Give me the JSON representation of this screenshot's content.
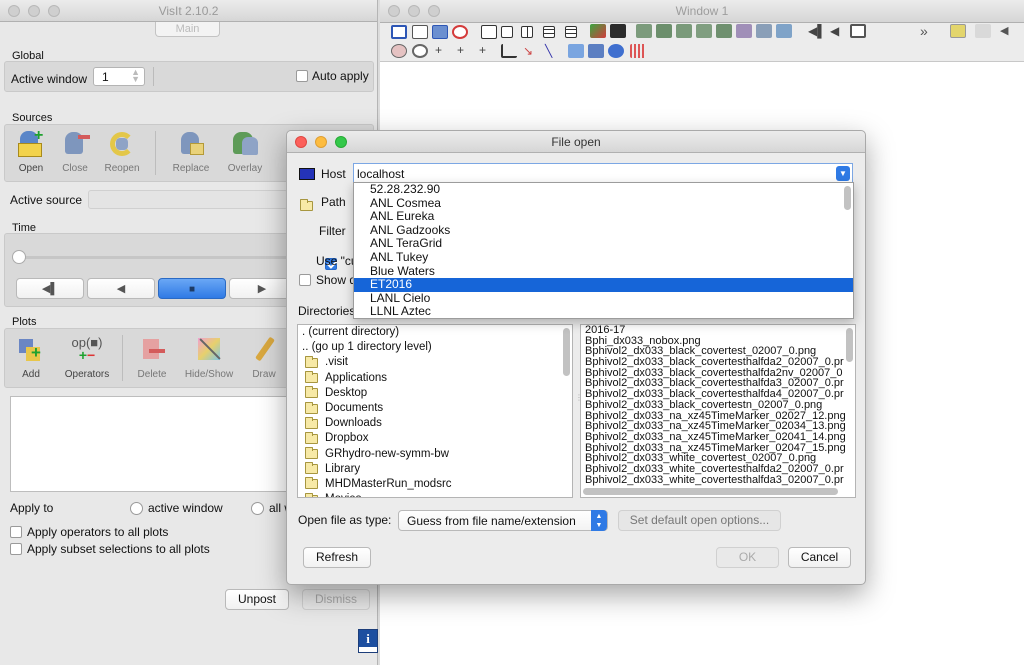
{
  "main_window": {
    "title": "VisIt 2.10.2",
    "tab_label": "Main",
    "global": {
      "label": "Global",
      "active_window_label": "Active window",
      "active_window_value": "1",
      "auto_apply_label": "Auto apply"
    },
    "sources": {
      "label": "Sources",
      "tools": [
        "Open",
        "Close",
        "Reopen",
        "Replace",
        "Overlay"
      ],
      "active_source_label": "Active source"
    },
    "time": {
      "label": "Time"
    },
    "plots": {
      "label": "Plots",
      "tools": [
        "Add",
        "Operators",
        "Delete",
        "Hide/Show",
        "Draw"
      ],
      "operators_icon_text": "op(■)"
    },
    "apply_to": {
      "label": "Apply to",
      "active_window": "active window",
      "all_windows": "all w",
      "apply_operators": "Apply operators to all plots",
      "apply_subset": "Apply subset selections to all plots"
    },
    "unpost_label": "Unpost",
    "dismiss_label": "Dismiss"
  },
  "viewer_window": {
    "title": "Window 1",
    "more_label": "»"
  },
  "file_open_dialog": {
    "title": "File open",
    "host_label": "Host",
    "host_value": "localhost",
    "path_label": "Path",
    "filter_label": "Filter",
    "use_current_label": "Use \"cu",
    "show_dot_label": "Show d",
    "directories_label": "Directories",
    "host_options": [
      "52.28.232.90",
      "ANL Cosmea",
      "ANL Eureka",
      "ANL Gadzooks",
      "ANL TeraGrid",
      "ANL Tukey",
      "Blue Waters",
      "ET2016",
      "LANL Cielo",
      "LLNL Aztec"
    ],
    "host_selected": "ET2016",
    "directories": [
      ". (current directory)",
      ".. (go up 1 directory level)",
      ".visit",
      "Applications",
      "Desktop",
      "Documents",
      "Downloads",
      "Dropbox",
      "GRhydro-new-symm-bw",
      "Library",
      "MHDMasterRun_modsrc",
      "Movies"
    ],
    "files": [
      "2016-17",
      "Bphi_dx033_nobox.png",
      "Bphivol2_dx033_black_covertest_02007_0.png",
      "Bphivol2_dx033_black_covertesthalfda2_02007_0.pr",
      "Bphivol2_dx033_black_covertesthalfda2nv_02007_0",
      "Bphivol2_dx033_black_covertesthalfda3_02007_0.pr",
      "Bphivol2_dx033_black_covertesthalfda4_02007_0.pr",
      "Bphivol2_dx033_black_covertestn_02007_0.png",
      "Bphivol2_dx033_na_xz45TimeMarker_02027_12.png",
      "Bphivol2_dx033_na_xz45TimeMarker_02034_13.png",
      "Bphivol2_dx033_na_xz45TimeMarker_02041_14.png",
      "Bphivol2_dx033_na_xz45TimeMarker_02047_15.png",
      "Bphivol2_dx033_white_covertest_02007_0.png",
      "Bphivol2_dx033_white_covertesthalfda2_02007_0.pr",
      "Bphivol2_dx033_white_covertesthalfda3_02007_0.pr"
    ],
    "open_as_label": "Open file as type:",
    "open_as_value": "Guess from file name/extension",
    "default_options_label": "Set default open options...",
    "refresh_label": "Refresh",
    "ok_label": "OK",
    "cancel_label": "Cancel"
  }
}
